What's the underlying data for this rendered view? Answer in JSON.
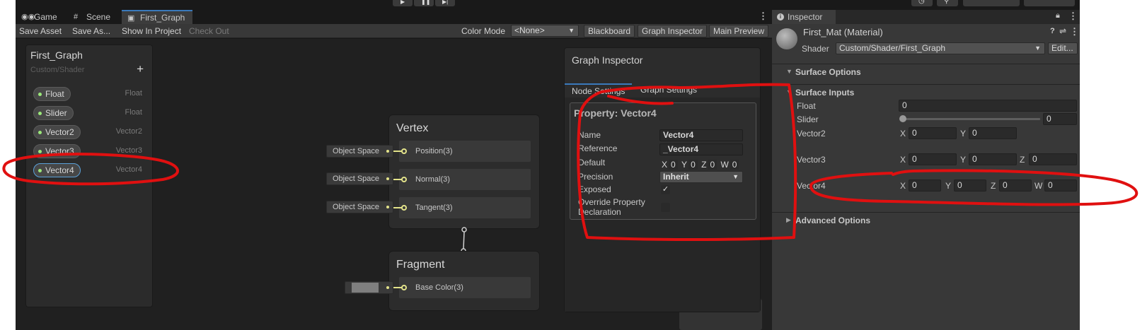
{
  "tabs": [
    {
      "label": "Game",
      "icon": "gamepad-icon"
    },
    {
      "label": "Scene",
      "icon": "hash-icon"
    },
    {
      "label": "First_Graph",
      "icon": "shader-graph-icon",
      "active": true
    }
  ],
  "toolbar": {
    "save_asset": "Save Asset",
    "save_as": "Save As...",
    "show_in_project": "Show In Project",
    "check_out": "Check Out",
    "color_mode_label": "Color Mode",
    "color_mode_value": "<None>",
    "blackboard": "Blackboard",
    "graph_inspector": "Graph Inspector",
    "main_preview": "Main Preview"
  },
  "blackboard": {
    "title": "First_Graph",
    "subtitle": "Custom/Shader",
    "add": "+",
    "properties": [
      {
        "name": "Float",
        "type": "Float"
      },
      {
        "name": "Slider",
        "type": "Float"
      },
      {
        "name": "Vector2",
        "type": "Vector2"
      },
      {
        "name": "Vector3",
        "type": "Vector3"
      },
      {
        "name": "Vector4",
        "type": "Vector4",
        "selected": true
      }
    ]
  },
  "vertex_node": {
    "title": "Vertex",
    "slots": [
      {
        "input": "Object Space",
        "label": "Position(3)"
      },
      {
        "input": "Object Space",
        "label": "Normal(3)"
      },
      {
        "input": "Object Space",
        "label": "Tangent(3)"
      }
    ]
  },
  "fragment_node": {
    "title": "Fragment",
    "slots": [
      {
        "label": "Base Color(3)",
        "swatch": "#7f7f7f"
      }
    ]
  },
  "graph_inspector": {
    "title": "Graph Inspector",
    "tab_node": "Node Settings",
    "tab_graph": "Graph Settings",
    "property_title": "Property: Vector4",
    "name_label": "Name",
    "name_value": "Vector4",
    "reference_label": "Reference",
    "reference_value": "_Vector4",
    "default_label": "Default",
    "default_values": {
      "x": "0",
      "y": "0",
      "z": "0",
      "w": "0"
    },
    "precision_label": "Precision",
    "precision_value": "Inherit",
    "exposed_label": "Exposed",
    "exposed_checked": true,
    "override_label_1": "Override Property",
    "override_label_2": "Declaration",
    "override_checked": false
  },
  "inspector": {
    "tab": "Inspector",
    "material_name": "First_Mat (Material)",
    "shader_label": "Shader",
    "shader_value": "Custom/Shader/First_Graph",
    "edit_button": "Edit...",
    "surface_options": "Surface Options",
    "surface_inputs": "Surface Inputs",
    "advanced_options": "Advanced Options",
    "fields": {
      "float_label": "Float",
      "float_value": "0",
      "slider_label": "Slider",
      "slider_value": "0",
      "slider_fraction": 0,
      "vector2_label": "Vector2",
      "vector2": {
        "x": "0",
        "y": "0"
      },
      "vector3_label": "Vector3",
      "vector3": {
        "x": "0",
        "y": "0",
        "z": "0"
      },
      "vector4_label": "Vector4",
      "vector4": {
        "x": "0",
        "y": "0",
        "z": "0",
        "w": "0"
      }
    },
    "axis_labels": {
      "x": "X",
      "y": "Y",
      "z": "Z",
      "w": "W"
    }
  },
  "colors": {
    "accent": "#3a79bb",
    "port": "#e3e38a",
    "annotation": "#e01010"
  }
}
